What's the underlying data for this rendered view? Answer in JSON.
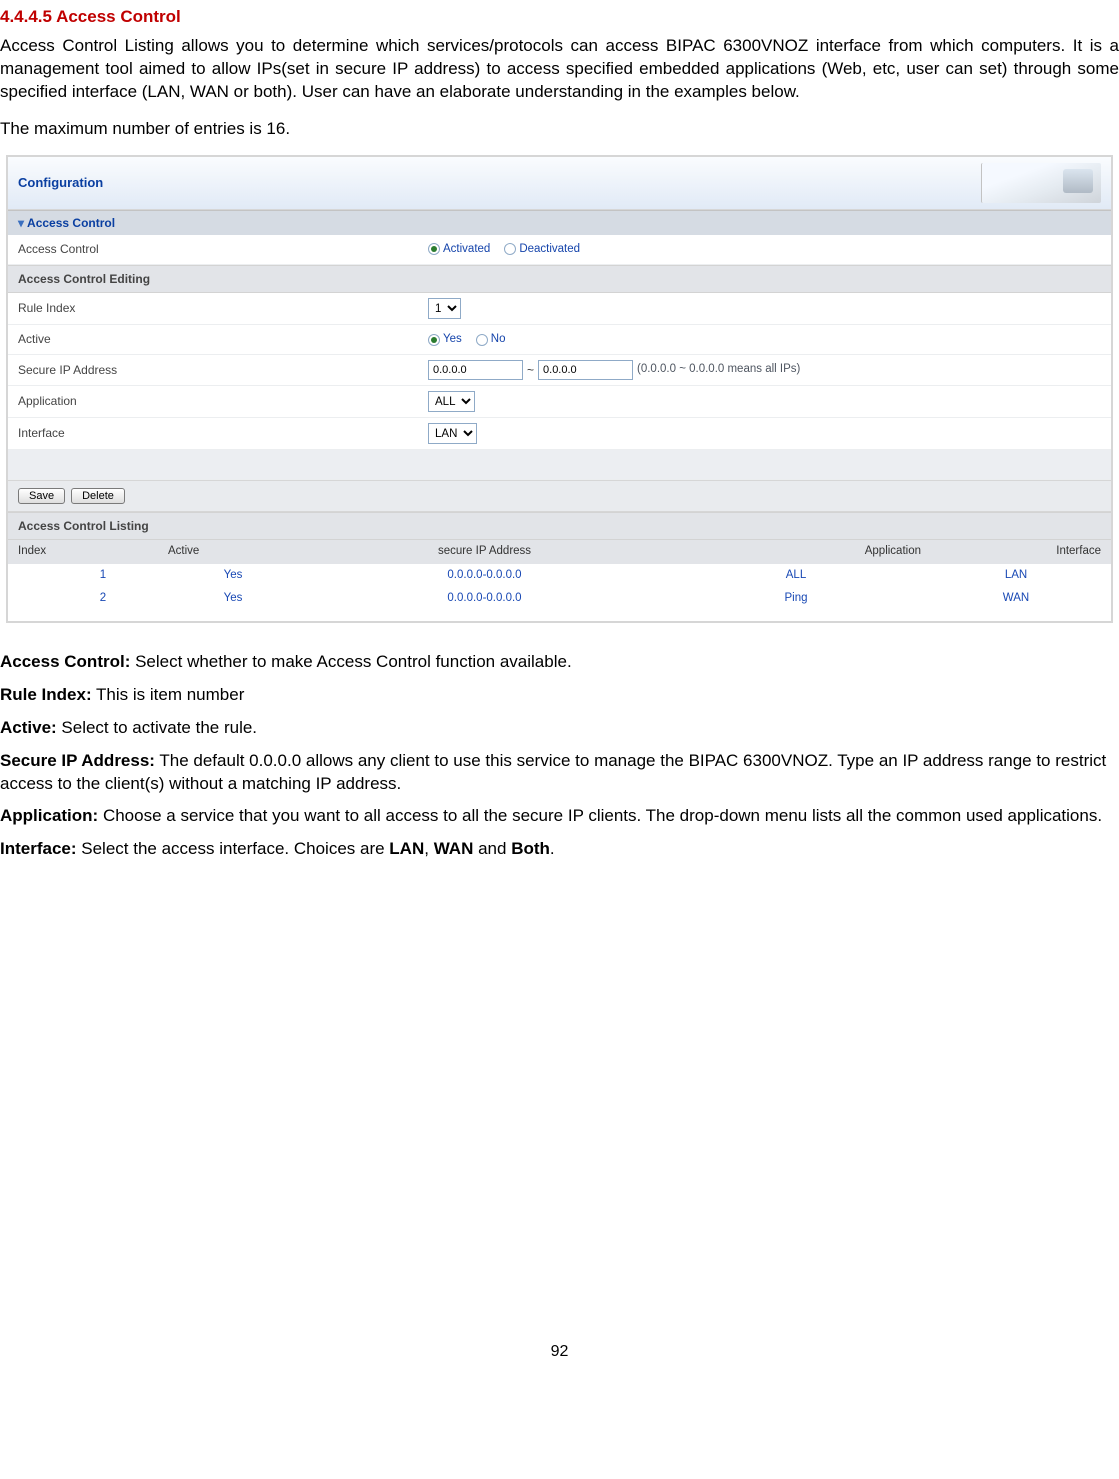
{
  "sec_title": "4.4.4.5 Access Control",
  "intro": "Access Control Listing allows you to determine which services/protocols can access BIPAC 6300VNOZ interface from which computers. It is a management tool aimed to allow IPs(set in secure IP address) to access specified embedded applications (Web, etc, user can set) through some specified interface (LAN, WAN or both). User can have an elaborate understanding in the examples below.",
  "max_line": "The maximum number of entries is 16.",
  "panel": {
    "head": "Configuration",
    "section": "Access Control",
    "fields": {
      "access_ctrl_lbl": "Access Control",
      "opt_activated": "Activated",
      "opt_deactivated": "Deactivated",
      "sub_edit": "Access Control Editing",
      "rule_index_lbl": "Rule Index",
      "rule_index_val": "1",
      "active_lbl": "Active",
      "opt_yes": "Yes",
      "opt_no": "No",
      "secure_ip_lbl": "Secure IP Address",
      "ip_from": "0.0.0.0",
      "ip_sep": "~",
      "ip_to": "0.0.0.0",
      "ip_hint": "(0.0.0.0 ~ 0.0.0.0 means all IPs)",
      "app_lbl": "Application",
      "app_val": "ALL",
      "if_lbl": "Interface",
      "if_val": "LAN",
      "btn_save": "Save",
      "btn_delete": "Delete",
      "sub_list": "Access Control Listing",
      "col_idx": "Index",
      "col_active": "Active",
      "col_ip": "secure IP Address",
      "col_app": "Application",
      "col_if": "Interface"
    },
    "rows": [
      {
        "idx": "1",
        "active": "Yes",
        "ip": "0.0.0.0-0.0.0.0",
        "app": "ALL",
        "if": "LAN"
      },
      {
        "idx": "2",
        "active": "Yes",
        "ip": "0.0.0.0-0.0.0.0",
        "app": "Ping",
        "if": "WAN"
      }
    ]
  },
  "desc": {
    "d1_b": "Access Control:",
    "d1": " Select whether to make Access Control function available.",
    "d2_b": "Rule Index:",
    "d2": " This is item number",
    "d3_b": "Active:",
    "d3": " Select to activate the rule.",
    "d4_b": "Secure IP Address:",
    "d4": " The default 0.0.0.0 allows any client to use this service to manage the BIPAC 6300VNOZ. Type an IP address range to restrict access to the client(s) without a matching IP address.",
    "d5_b": "Application:",
    "d5": " Choose a service that you want to all access to all the secure IP clients. The drop-down menu lists all the common used applications.",
    "d6_b": "Interface:",
    "d6_a": " Select the access interface. Choices are ",
    "d6_lan": "LAN",
    "d6_c": ", ",
    "d6_wan": "WAN",
    "d6_d": " and ",
    "d6_both": "Both",
    "d6_e": "."
  },
  "page_num": "92"
}
